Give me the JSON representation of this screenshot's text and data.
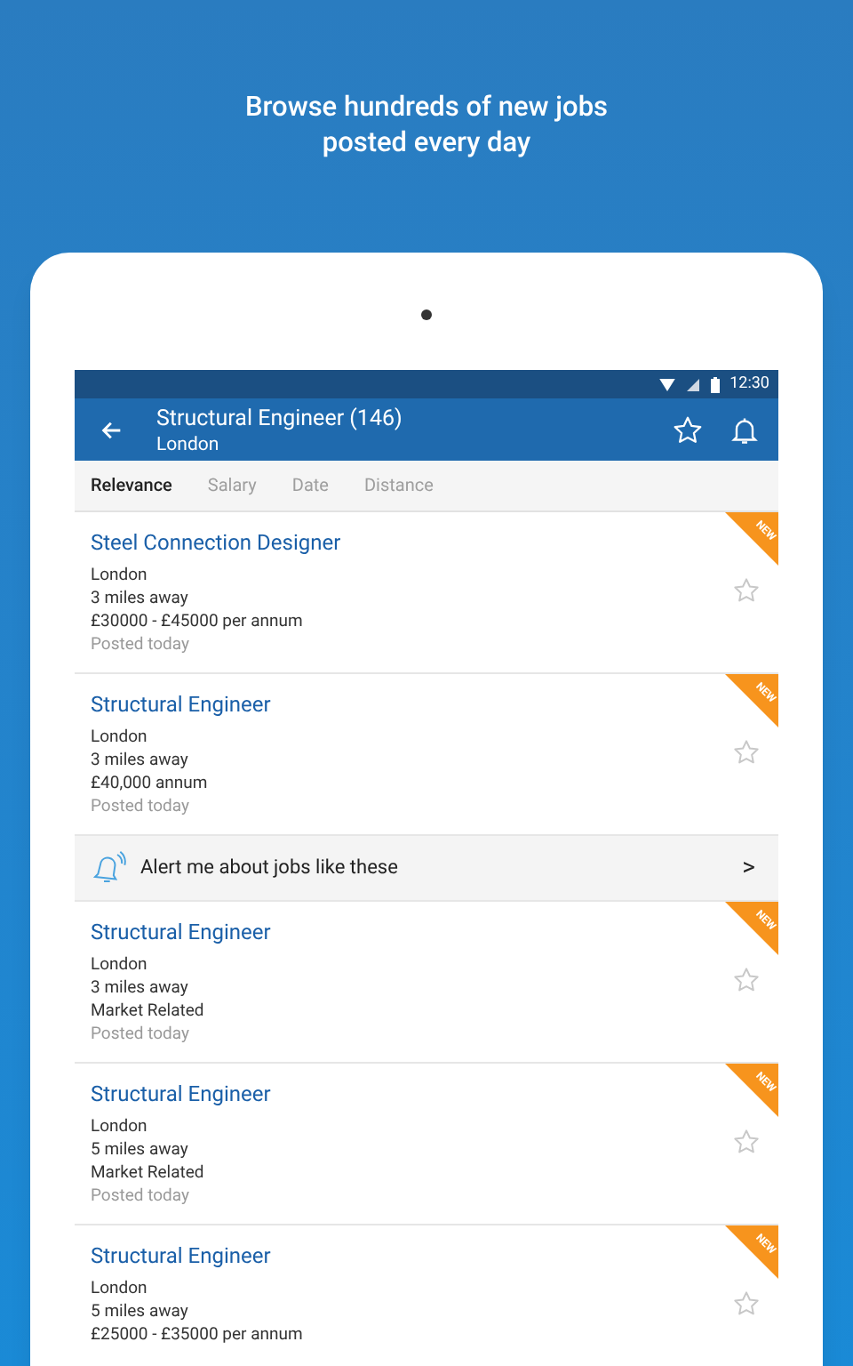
{
  "headline": [
    "Browse hundreds of new jobs",
    "posted every day"
  ],
  "status_bar": {
    "time": "12:30"
  },
  "toolbar": {
    "title": "Structural Engineer (146)",
    "subtitle": "London"
  },
  "sort_tabs": [
    {
      "label": "Relevance",
      "selected": true
    },
    {
      "label": "Salary",
      "selected": false
    },
    {
      "label": "Date",
      "selected": false
    },
    {
      "label": "Distance",
      "selected": false
    }
  ],
  "items": [
    {
      "kind": "job",
      "title": "Steel Connection Designer",
      "location": "London",
      "distance": "3 miles away",
      "salary": "£30000 - £45000 per annum",
      "posted": "Posted today",
      "badge": "NEW",
      "saved": false
    },
    {
      "kind": "job",
      "title": "Structural Engineer",
      "location": "London",
      "distance": "3 miles away",
      "salary": "£40,000 annum",
      "posted": "Posted today",
      "badge": "NEW",
      "saved": false
    },
    {
      "kind": "alert",
      "label": "Alert me about jobs like these",
      "chevron": ">"
    },
    {
      "kind": "job",
      "title": "Structural Engineer",
      "location": "London",
      "distance": "3 miles away",
      "salary": "Market Related",
      "posted": "Posted today",
      "badge": "NEW",
      "saved": false
    },
    {
      "kind": "job",
      "title": "Structural Engineer",
      "location": "London",
      "distance": "5 miles away",
      "salary": "Market Related",
      "posted": "Posted today",
      "badge": "NEW",
      "saved": false
    },
    {
      "kind": "job",
      "title": "Structural Engineer",
      "location": "London",
      "distance": "5 miles away",
      "salary": "£25000 - £35000 per annum",
      "badge": "NEW",
      "saved": false
    }
  ]
}
